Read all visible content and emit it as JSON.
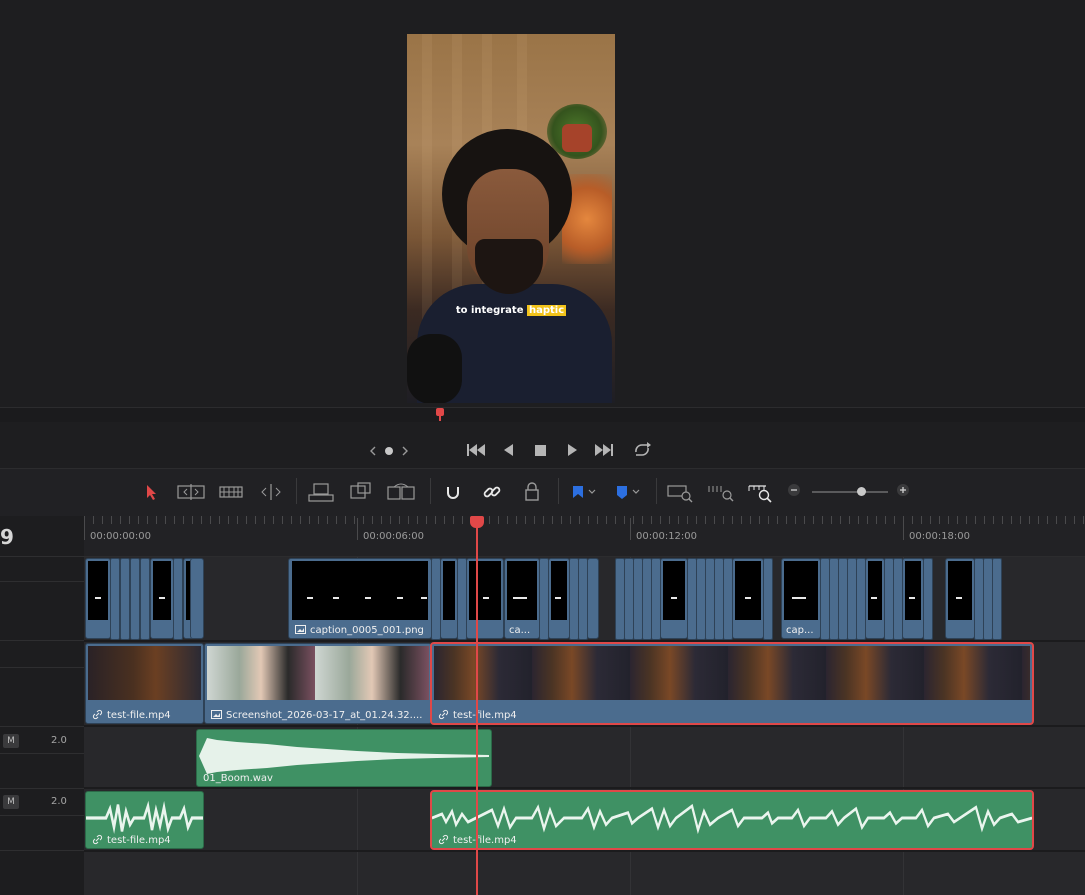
{
  "viewer": {
    "caption_text": "to integrate",
    "caption_highlight": "haptic"
  },
  "transport": {
    "prev_clip_icon": "chevron-left",
    "dot_icon": "dot",
    "next_clip_icon": "chevron-right",
    "first_frame_icon": "⏮",
    "reverse_icon": "◀",
    "stop_icon": "■",
    "play_icon": "▶",
    "last_frame_icon": "⏭",
    "loop_icon": "loop"
  },
  "toolbar": {
    "accent": "#e04848",
    "tools": [
      "selection-arrow",
      "trim-edit",
      "dynamic-trim",
      "blade-edit",
      "overwrite",
      "replace",
      "ripple-overwrite",
      "snapping",
      "linked-selection",
      "position-lock",
      "flag",
      "marker",
      "zoom-full",
      "zoom-detail",
      "zoom-custom"
    ]
  },
  "header": {
    "timecode_partial": "9"
  },
  "ruler": {
    "timecodes": [
      "00:00:00:00",
      "00:00:06:00",
      "00:00:12:00",
      "00:00:18:00"
    ]
  },
  "tracks": {
    "audio1": {
      "mute": "M",
      "volume": "2.0"
    },
    "audio2": {
      "mute": "M",
      "volume": "2.0"
    }
  },
  "clips": {
    "caption_track": {
      "label_main": "caption_0005_001.png",
      "label_a": "ca...",
      "label_b": "cap..."
    },
    "video_track": {
      "clip1": "test-file.mp4",
      "clip2": "Screenshot_2026-03-17_at_01.24.32....",
      "clip3": "test-file.mp4"
    },
    "audio1": {
      "clip1": "01_Boom.wav"
    },
    "audio2": {
      "clip1": "test-file.mp4",
      "clip2": "test-file.mp4"
    }
  },
  "colors": {
    "video_clip": "#4b6c8e",
    "audio_clip": "#3f9164",
    "selection": "#e04848",
    "playhead": "#e04848"
  }
}
